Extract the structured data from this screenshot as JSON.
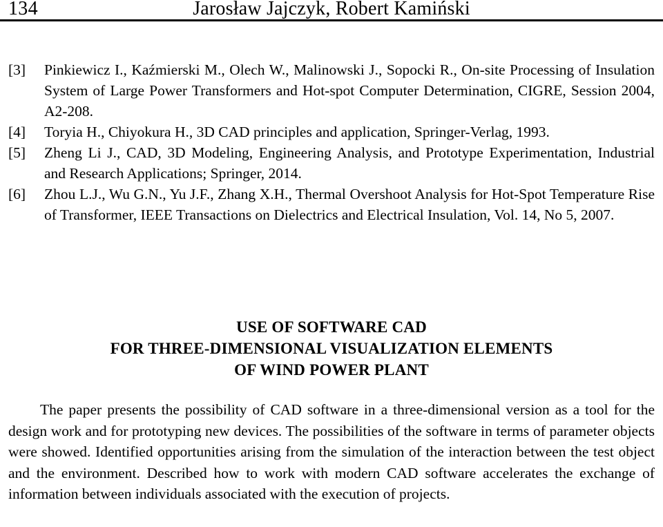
{
  "running_head": {
    "page_number": "134",
    "authors": "Jarosław Jajczyk, Robert Kamiński"
  },
  "references": [
    {
      "label": "[3]",
      "text": "Pinkiewicz I., Kaźmierski M., Olech W., Malinowski J., Sopocki R., On-site Processing of Insulation System of Large Power Transformers and Hot-spot Computer Determination, CIGRE, Session 2004, A2-208."
    },
    {
      "label": "[4]",
      "text": "Toryia H., Chiyokura H., 3D CAD principles and application, Springer-Verlag, 1993."
    },
    {
      "label": "[5]",
      "text": "Zheng Li J., CAD, 3D Modeling, Engineering Analysis, and Prototype Experimentation, Industrial and Research Applications; Springer, 2014."
    },
    {
      "label": "[6]",
      "text": "Zhou L.J., Wu G.N., Yu J.F., Zhang X.H., Thermal Overshoot Analysis for Hot-Spot Temperature Rise of Transformer, IEEE Transactions on Dielectrics and Electrical Insulation, Vol. 14, No 5, 2007."
    }
  ],
  "article": {
    "title_lines": [
      "USE OF SOFTWARE CAD",
      "FOR THREE-DIMENSIONAL VISUALIZATION ELEMENTS",
      "OF WIND POWER PLANT"
    ],
    "abstract": "The paper presents the possibility of CAD software in a three-dimensional version as a tool for the design work and for prototyping new devices. The possibilities of the software in terms of parameter objects were showed. Identified opportunities arising from the simulation of the interaction between the test object and the environment. Described how to work with modern CAD software accelerates the exchange of information between individuals associated with the execution of projects."
  }
}
